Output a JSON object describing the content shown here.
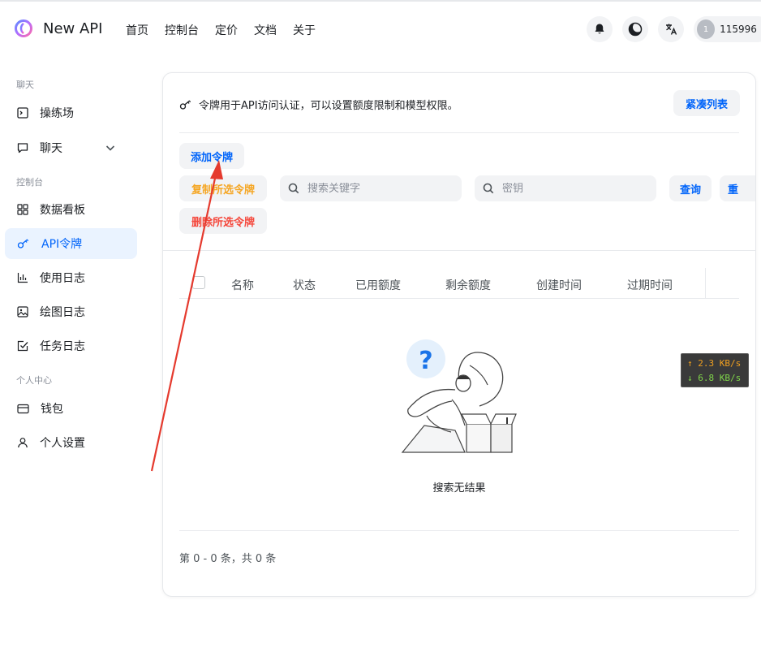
{
  "header": {
    "brand": "New API",
    "nav": [
      "首页",
      "控制台",
      "定价",
      "文档",
      "关于"
    ],
    "user": {
      "avatar_initial": "1",
      "name": "115996"
    }
  },
  "sidebar": {
    "sections": {
      "chat": "聊天",
      "console": "控制台",
      "personal": "个人中心"
    },
    "items": [
      {
        "label": "操练场",
        "icon": "playground-icon"
      },
      {
        "label": "聊天",
        "icon": "chat-icon"
      },
      {
        "label": "数据看板",
        "icon": "dashboard-icon"
      },
      {
        "label": "API令牌",
        "icon": "key-icon",
        "active": true
      },
      {
        "label": "使用日志",
        "icon": "bar-chart-icon"
      },
      {
        "label": "绘图日志",
        "icon": "image-icon"
      },
      {
        "label": "任务日志",
        "icon": "task-icon"
      },
      {
        "label": "钱包",
        "icon": "wallet-icon"
      },
      {
        "label": "个人设置",
        "icon": "user-icon"
      }
    ]
  },
  "main": {
    "description": "令牌用于API访问认证，可以设置额度限制和模型权限。",
    "compact_button": "紧凑列表",
    "add_button": "添加令牌",
    "copy_button": "复制所选令牌",
    "delete_button": "删除所选令牌",
    "search_placeholder": "搜索关键字",
    "key_placeholder": "密钥",
    "query_button": "查询",
    "reset_button": "重",
    "table": {
      "columns": [
        "名称",
        "状态",
        "已用额度",
        "剩余额度",
        "创建时间",
        "过期时间"
      ]
    },
    "empty_text": "搜索无结果",
    "pagination": "第 0 - 0 条，共 0 条"
  },
  "speed": {
    "up": "↑ 2.3 KB/s",
    "down": "↓ 6.8 KB/s"
  },
  "colors": {
    "accent": "#0064fa",
    "copy": "#f5a623",
    "delete": "#f5493d",
    "arrow": "#e53a2e"
  }
}
